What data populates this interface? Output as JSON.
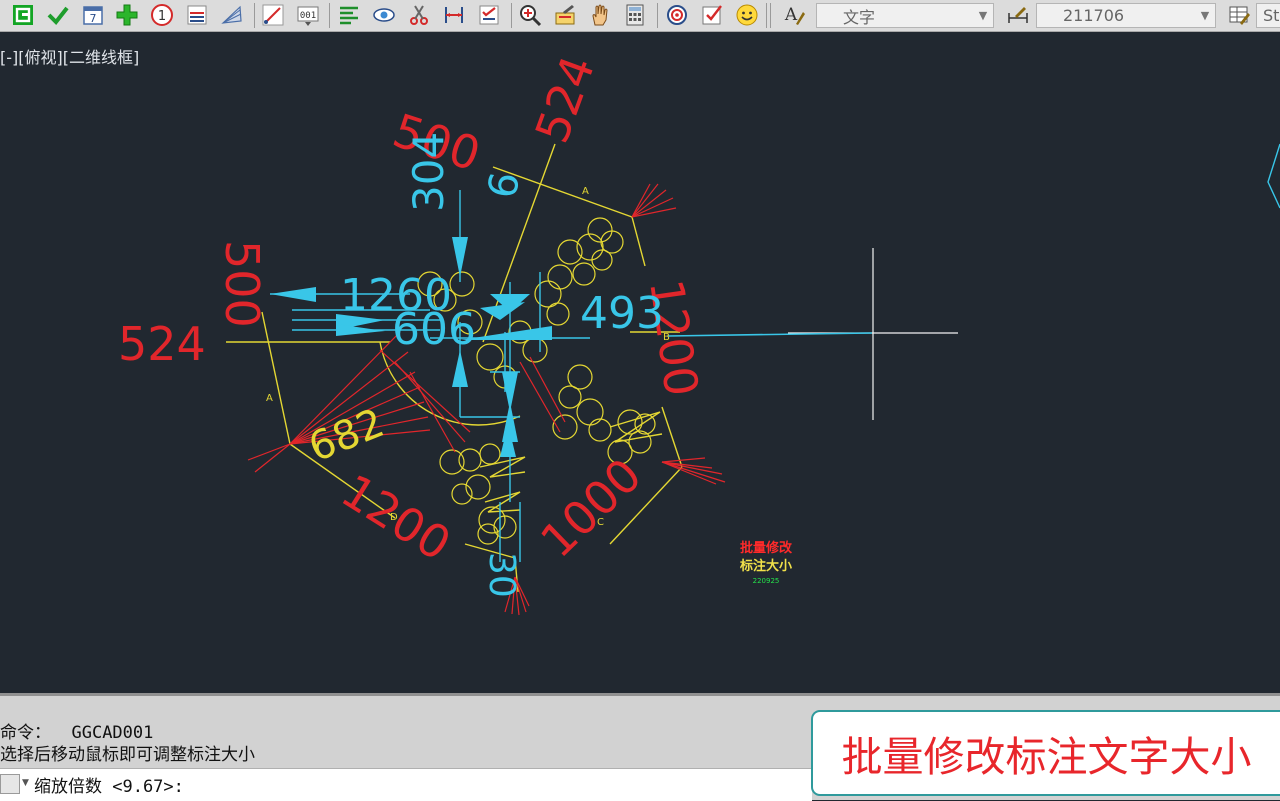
{
  "toolbar": {
    "icons": [
      "layer-icon",
      "check-icon",
      "calendar-icon",
      "add-icon",
      "number-circle-icon",
      "list-numbers-icon",
      "fan-icon",
      "line-measure-icon",
      "counter-icon",
      "align-icon",
      "eye-icon",
      "scissors-icon",
      "dimension-icon",
      "checklist-icon",
      "zoom-icon",
      "edit-text-icon",
      "hand-icon",
      "calculator-icon",
      "target-icon",
      "task-icon",
      "smiley-icon",
      "text-style-icon",
      "dim-style-icon",
      "table-style-icon"
    ],
    "text_style_value": "文字",
    "dim_style_value": "211706",
    "table_style_value": "St"
  },
  "viewport": {
    "view_label": "[-][俯视][二维线框]",
    "dimensions": {
      "d524_left": "524",
      "d524_top": "524",
      "d500_left": "500",
      "d500_top": "500",
      "d304": "304",
      "d1200": "1200",
      "d1000": "1000",
      "d1200_right": "1200",
      "d682": "682",
      "d493": "493",
      "d1260": "1260",
      "d606": "606",
      "d6": "6",
      "d30": "30"
    },
    "markers": {
      "A_top": "A",
      "A_left": "A",
      "B": "B",
      "C": "C",
      "D": "D"
    },
    "block_title_1": "批量修改",
    "block_title_2": "标注大小",
    "block_code": "220925"
  },
  "command": {
    "line1_prompt": "命令：",
    "line1_value": "GGCAD001",
    "line2": "选择后移动鼠标即可调整标注大小",
    "input_prompt": "缩放倍数 <9.67>:"
  },
  "caption": "批量修改标注文字大小",
  "colors": {
    "background": "#212830",
    "red": "#e1262b",
    "cyan": "#39c6e8",
    "yellow": "#e4d733",
    "green": "#24e24a"
  }
}
